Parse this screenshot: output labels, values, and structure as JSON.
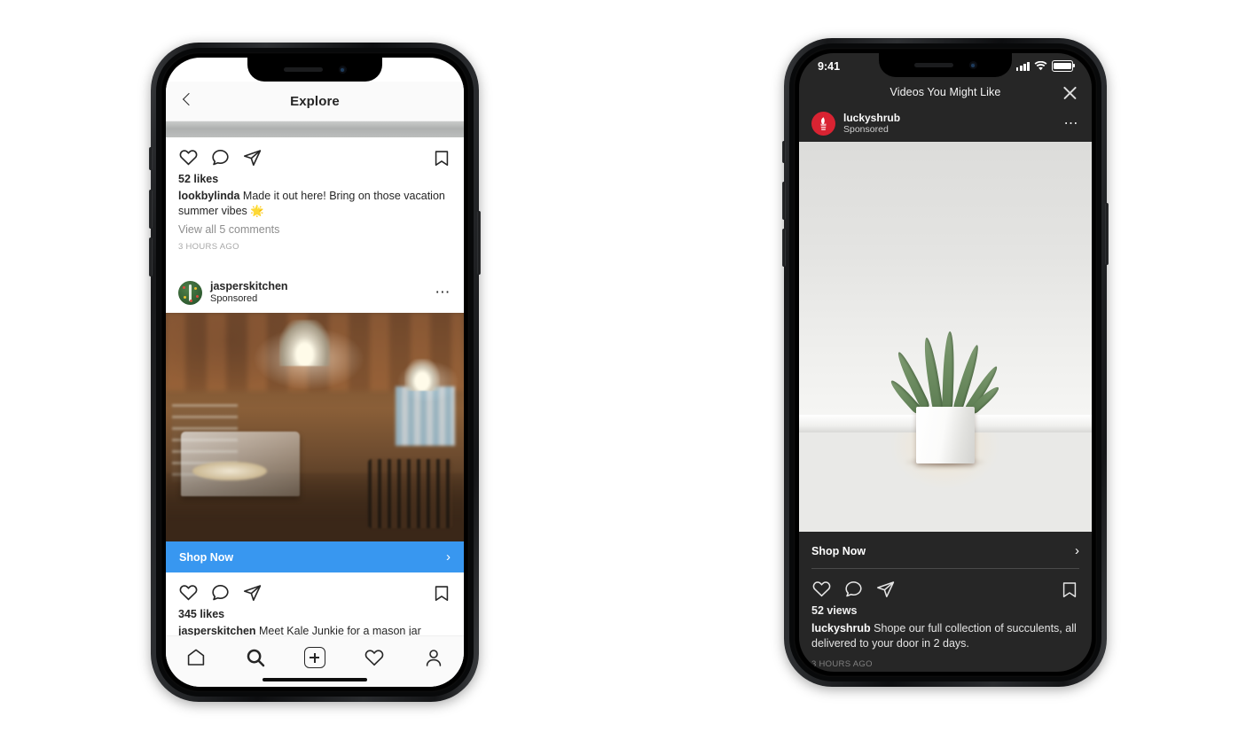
{
  "phone_light": {
    "nav": {
      "back_icon": "chevron-left-icon",
      "title": "Explore"
    },
    "post_top": {
      "actions": {
        "like": "heart-icon",
        "comment": "comment-icon",
        "share": "share-icon",
        "save": "bookmark-icon"
      },
      "likes": "52 likes",
      "caption_user": "lookbylinda",
      "caption_text": " Made it out here! Bring on those vacation summer vibes 🌟",
      "comments_link": "View all 5 comments",
      "timestamp": "3 HOURS AGO"
    },
    "ad": {
      "username": "jasperskitchen",
      "subtitle": "Sponsored",
      "menu_icon": "more-options-icon",
      "avatar_icon": "jasperskitchen-avatar",
      "photo_alt": "kitchen-shop-interior-photo",
      "cta_label": "Shop Now",
      "cta_chevron": "›",
      "cta_color": "#3897f0",
      "actions": {
        "like": "heart-icon",
        "comment": "comment-icon",
        "share": "share-icon",
        "save": "bookmark-icon"
      },
      "likes": "345 likes",
      "caption_user": "jasperskitchen",
      "caption_text": " Meet Kale Junkie for a mason jar"
    },
    "tabbar": {
      "home": "home-icon",
      "search": "search-icon",
      "create": "new-post-icon",
      "activity": "heart-icon",
      "profile": "profile-icon"
    }
  },
  "phone_dark": {
    "status": {
      "time": "9:41",
      "signal_icon": "cellular-signal-icon",
      "wifi_icon": "wifi-icon",
      "battery_icon": "battery-icon"
    },
    "nav": {
      "title": "Videos You Might Like",
      "close_icon": "close-icon"
    },
    "ad": {
      "username": "luckyshrub",
      "subtitle": "Sponsored",
      "menu_icon": "more-options-icon",
      "avatar_icon": "luckyshrub-avatar",
      "photo_alt": "succulent-in-white-pot-photo",
      "cta_label": "Shop Now",
      "cta_chevron": "›",
      "actions": {
        "like": "heart-icon",
        "comment": "comment-icon",
        "share": "share-icon",
        "save": "bookmark-icon"
      },
      "views": "52 views",
      "caption_user": "luckyshrub",
      "caption_text": " Shope our full collection of succulents, all delivered to your door in 2 days.",
      "timestamp": "3 HOURS AGO"
    },
    "background_color": "#262626"
  }
}
